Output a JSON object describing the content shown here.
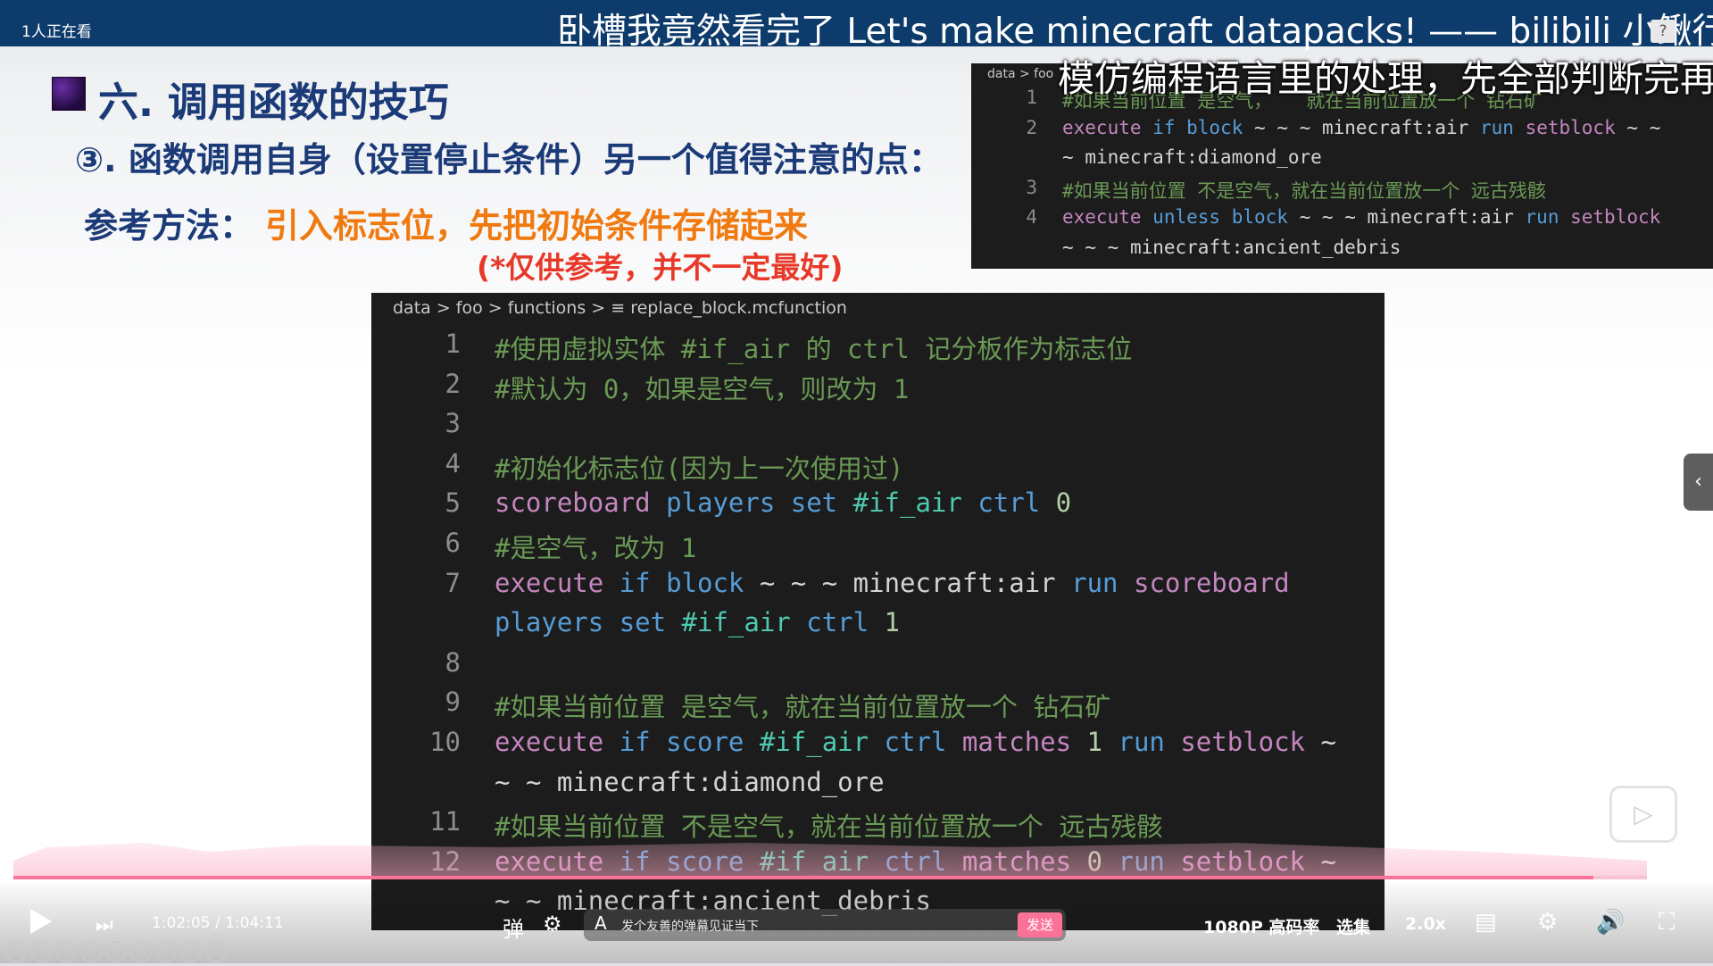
{
  "top_bar": {
    "viewers": "1人正在看",
    "video_title": "卧槽我竟然看完了   Let's make minecraft datapacks! —— bilibili 小鳅行"
  },
  "slide": {
    "heading": "六. 调用函数的技巧",
    "subheading": "③. 函数调用自身（设置停止条件）另一个值得注意的点：",
    "reference_label": "参考方法：",
    "reference_text": "引入标志位，先把初始条件存储起来",
    "reference_note": "(*仅供参考，并不一定最好)"
  },
  "subtitle": "模仿编程语言里的处理，先全部判断完再执",
  "small_code": {
    "breadcrumb": "data > foo",
    "lines": [
      {
        "num": "1",
        "text": "#如果当前位置 是空气，   就在当前位置放一个 钻石矿"
      },
      {
        "num": "2",
        "text": "execute if block ~ ~ ~ minecraft:air run setblock ~ ~"
      },
      {
        "num": "",
        "text": "~ minecraft:diamond_ore"
      },
      {
        "num": "3",
        "text": "#如果当前位置 不是空气，就在当前位置放一个 远古残骸"
      },
      {
        "num": "4",
        "text": "execute unless block ~ ~ ~ minecraft:air run setblock"
      },
      {
        "num": "",
        "text": "~ ~ ~ minecraft:ancient_debris"
      }
    ]
  },
  "big_code": {
    "breadcrumb": "data > foo > functions > ≡ replace_block.mcfunction",
    "lines": [
      {
        "num": "1",
        "text": "#使用虚拟实体 #if_air 的 ctrl 记分板作为标志位"
      },
      {
        "num": "2",
        "text": "#默认为 0，如果是空气，则改为 1"
      },
      {
        "num": "3",
        "text": ""
      },
      {
        "num": "4",
        "text": "#初始化标志位(因为上一次使用过)"
      },
      {
        "num": "5",
        "text": "scoreboard players set #if_air ctrl 0"
      },
      {
        "num": "6",
        "text": "#是空气，改为 1"
      },
      {
        "num": "7",
        "text": "execute if block ~ ~ ~ minecraft:air run scoreboard"
      },
      {
        "num": "",
        "text": "players set #if_air ctrl 1"
      },
      {
        "num": "8",
        "text": ""
      },
      {
        "num": "9",
        "text": "#如果当前位置 是空气，就在当前位置放一个 钻石矿"
      },
      {
        "num": "10",
        "text": "execute if score #if_air ctrl matches 1 run setblock ~"
      },
      {
        "num": "",
        "text": "~ ~ minecraft:diamond_ore"
      },
      {
        "num": "11",
        "text": "#如果当前位置 不是空气，就在当前位置放一个 远古残骸"
      },
      {
        "num": "12",
        "text": "execute if score #if_air ctrl matches 0 run setblock ~"
      },
      {
        "num": "",
        "text": "~ ~ minecraft:ancient_debris"
      }
    ]
  },
  "player": {
    "current_time": "1:02:05",
    "separator": "/",
    "total_time": "1:04:11",
    "progress_fraction": 0.967,
    "danmaku_placeholder": "发个友善的弹幕见证当下",
    "send_label": "发送",
    "quality_label": "1080P 高码率",
    "episodes_label": "选集",
    "speed_label": "2.0x",
    "accent_color": "#fb7299",
    "icons": [
      "play-icon",
      "next-icon",
      "danmaku-toggle-icon",
      "danmaku-settings-icon",
      "subtitle-icon",
      "settings-gear-icon",
      "volume-icon",
      "fullscreen-icon"
    ]
  }
}
